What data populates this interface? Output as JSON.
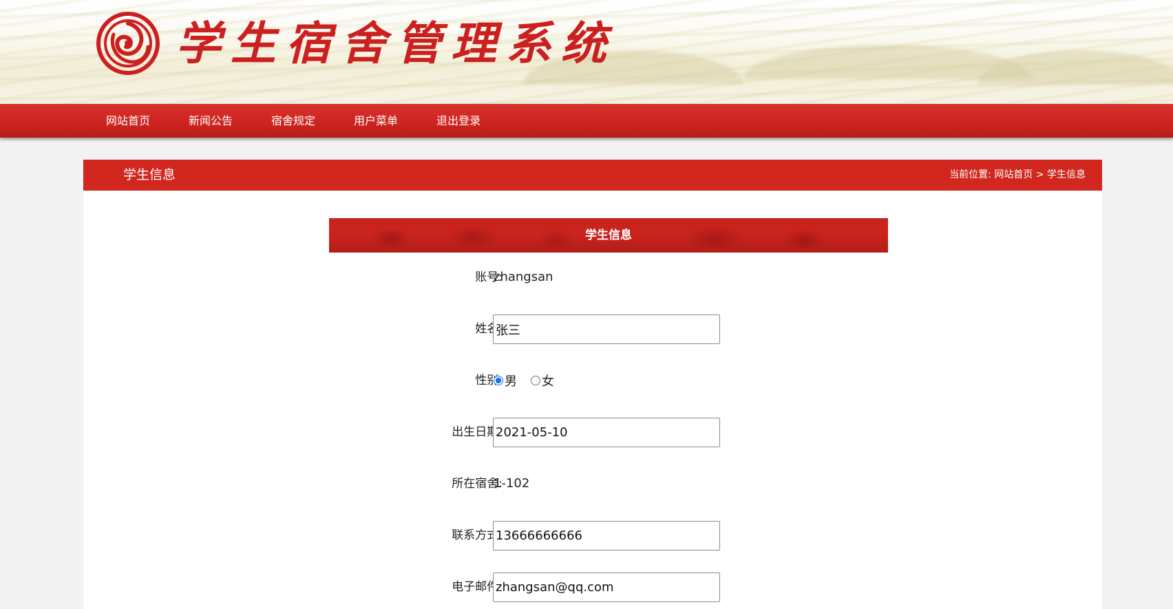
{
  "site": {
    "title": "学生宿舍管理系统"
  },
  "nav": {
    "items": [
      "网站首页",
      "新闻公告",
      "宿舍规定",
      "用户菜单",
      "退出登录"
    ]
  },
  "page": {
    "title": "学生信息",
    "breadcrumb": {
      "prefix": "当前位置:",
      "home": "网站首页",
      "separator": ">",
      "current": "学生信息"
    }
  },
  "form": {
    "header": "学生信息",
    "account": {
      "label": "账号:",
      "value": "zhangsan"
    },
    "name": {
      "label": "姓名:",
      "value": "张三"
    },
    "gender": {
      "label": "性别:",
      "options": [
        "男",
        "女"
      ],
      "selected": "男"
    },
    "birthdate": {
      "label": "出生日期:",
      "value": "2021-05-10"
    },
    "dorm": {
      "label": "所在宿舍:",
      "value": "1-102"
    },
    "phone": {
      "label": "联系方式:",
      "value": "13666666666"
    },
    "email": {
      "label": "电子邮件:",
      "value": "zhangsan@qq.com"
    }
  },
  "colors": {
    "brand_red": "#cc1f1f",
    "nav_red": "#cb2420",
    "panel_head": "#d1271f"
  }
}
